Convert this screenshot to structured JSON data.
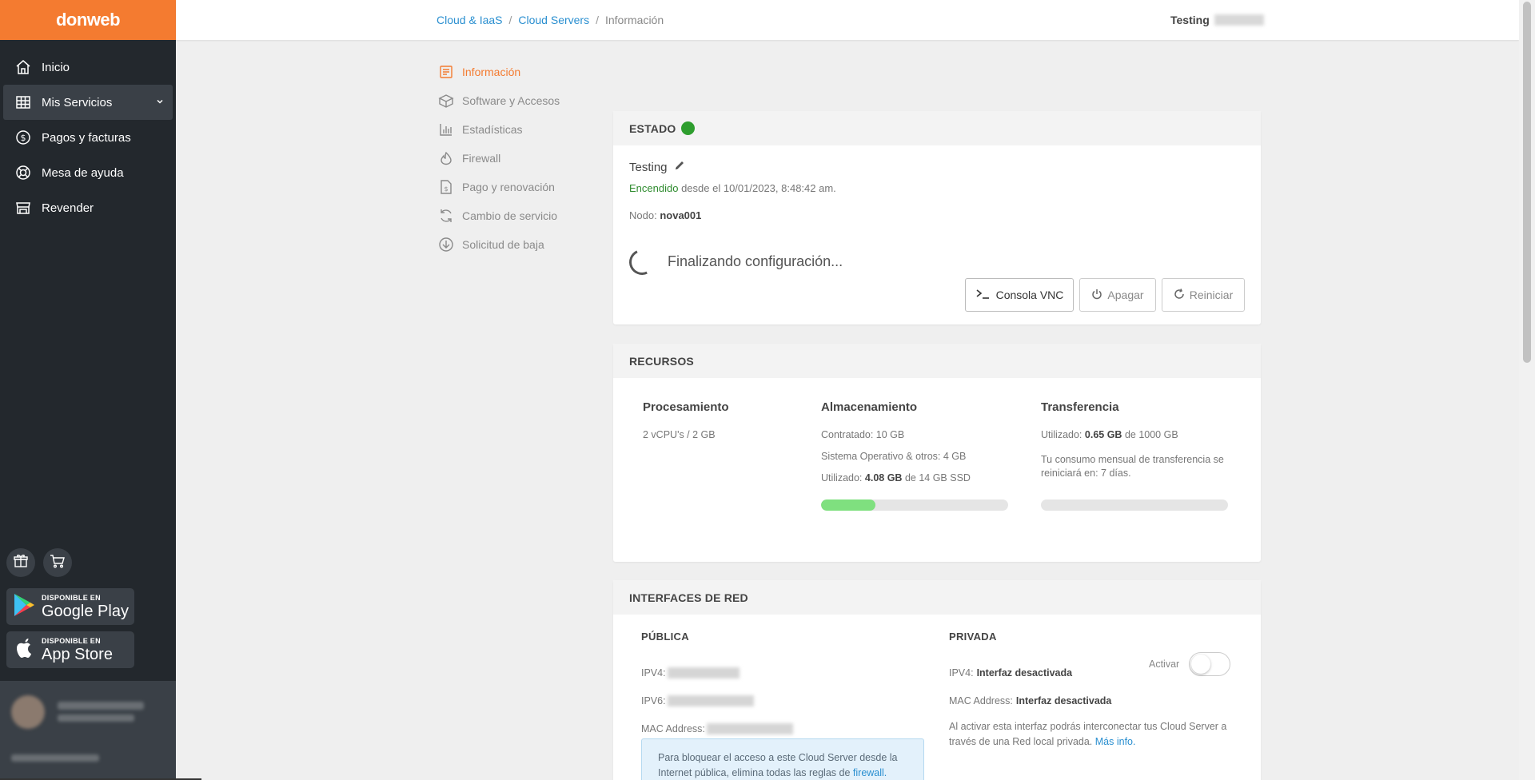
{
  "brand": {
    "logo_text": "donweb"
  },
  "sidebar": {
    "items": [
      {
        "label": "Inicio",
        "icon": "home-icon"
      },
      {
        "label": "Mis Servicios",
        "icon": "grid-icon"
      },
      {
        "label": "Pagos y facturas",
        "icon": "dollar-icon"
      },
      {
        "label": "Mesa de ayuda",
        "icon": "lifebuoy-icon"
      },
      {
        "label": "Revender",
        "icon": "store-icon"
      }
    ],
    "google_play": {
      "small": "DISPONIBLE EN",
      "big": "Google Play"
    },
    "app_store": {
      "small": "DISPONIBLE EN",
      "big": "App Store"
    }
  },
  "topbar": {
    "breadcrumb": [
      "Cloud & IaaS",
      "Cloud Servers",
      "Información"
    ],
    "user_label": "Testing"
  },
  "submenu": [
    {
      "label": "Información",
      "icon": "document-icon"
    },
    {
      "label": "Software y Accesos",
      "icon": "box-icon"
    },
    {
      "label": "Estadísticas",
      "icon": "bar-chart-icon"
    },
    {
      "label": "Firewall",
      "icon": "flame-icon"
    },
    {
      "label": "Pago y renovación",
      "icon": "invoice-icon"
    },
    {
      "label": "Cambio de servicio",
      "icon": "refresh-icon"
    },
    {
      "label": "Solicitud de baja",
      "icon": "arrow-down-circle-icon"
    }
  ],
  "estado": {
    "title": "ESTADO",
    "status_color": "#2e9e2e",
    "server_name": "Testing",
    "state_word": "Encendido",
    "state_rest": "desde el 10/01/2023, 8:48:42 am.",
    "node_label": "Nodo:",
    "node_value": "nova001",
    "progress_text": "Finalizando configuración...",
    "buttons": {
      "vnc": "Consola VNC",
      "off": "Apagar",
      "restart": "Reiniciar"
    }
  },
  "recursos": {
    "title": "RECURSOS",
    "procesamiento": {
      "title": "Procesamiento",
      "value": "2 vCPU's / 2 GB"
    },
    "almacenamiento": {
      "title": "Almacenamiento",
      "contratado": "Contratado: 10 GB",
      "so": "Sistema Operativo & otros: 4 GB",
      "used_label": "Utilizado:",
      "used_value": "4.08 GB",
      "used_rest": "de 14 GB SSD",
      "used_fraction": 0.29
    },
    "transferencia": {
      "title": "Transferencia",
      "used_label": "Utilizado:",
      "used_value": "0.65 GB",
      "used_rest": "de 1000 GB",
      "note": "Tu consumo mensual de transferencia se reiniciará en: 7 días.",
      "used_fraction": 0.0
    }
  },
  "interfaces": {
    "title": "INTERFACES DE RED",
    "publica": {
      "title": "PÚBLICA",
      "ipv4_label": "IPV4:",
      "ipv6_label": "IPV6:",
      "mac_label": "MAC Address:",
      "info_text": "Para bloquear el acceso a este Cloud Server desde la Internet pública, elimina todas las reglas de",
      "info_link": "firewall."
    },
    "privada": {
      "title": "PRIVADA",
      "ipv4_label": "IPV4:",
      "ipv4_value": "Interfaz desactivada",
      "mac_label": "MAC Address:",
      "mac_value": "Interfaz desactivada",
      "toggle_label": "Activar",
      "note": "Al activar esta interfaz podrás interconectar tus Cloud Server a través de una Red local privada.",
      "note_link": "Más info."
    }
  }
}
